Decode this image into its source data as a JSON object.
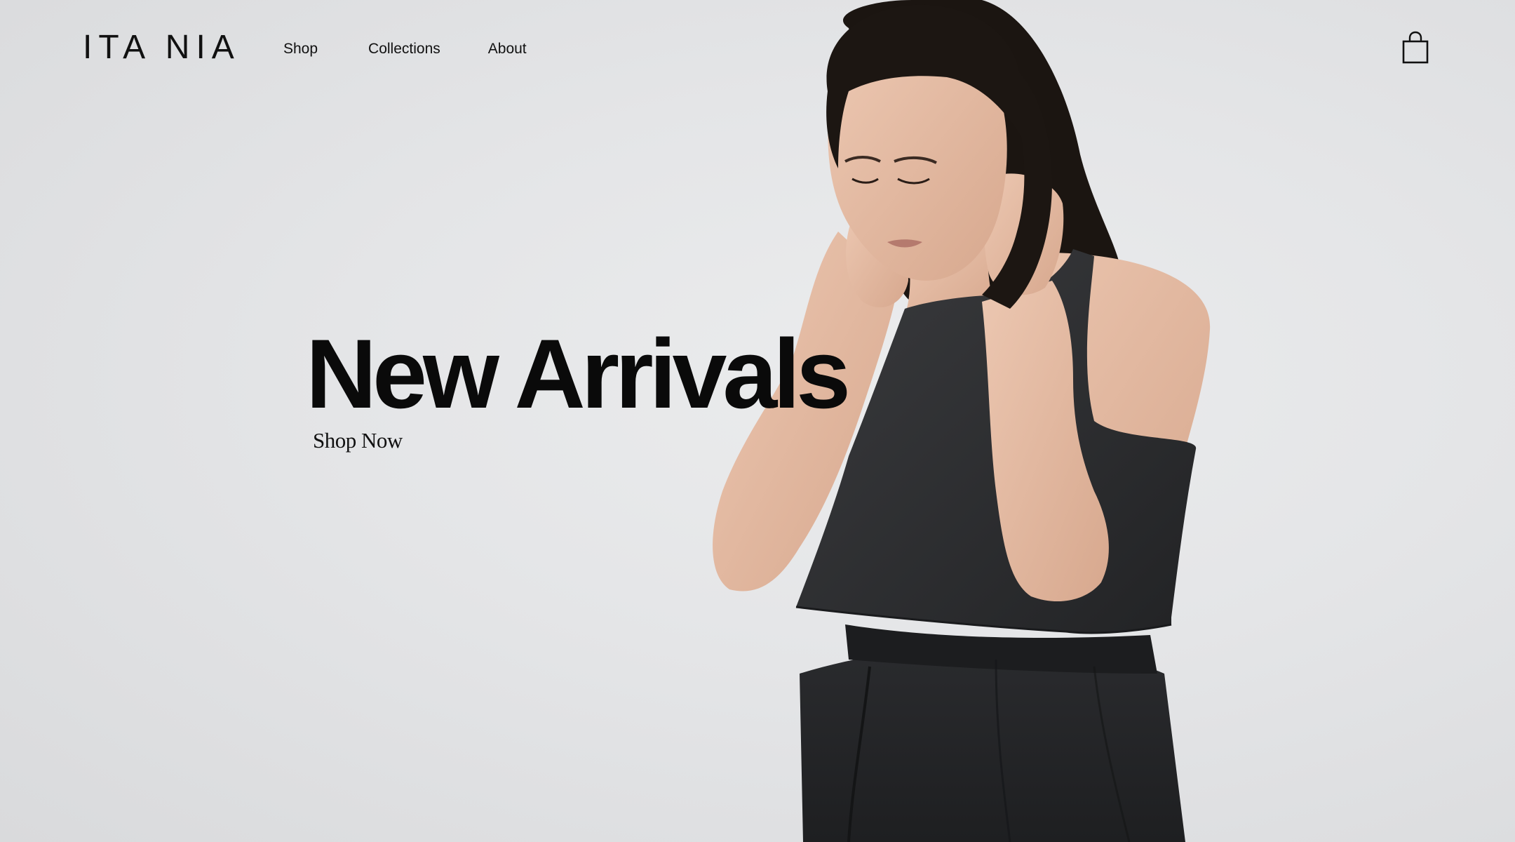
{
  "brand": {
    "logo_text": "ITA NIA"
  },
  "nav": {
    "items": [
      {
        "label": "Shop"
      },
      {
        "label": "Collections"
      },
      {
        "label": "About"
      }
    ]
  },
  "header": {
    "cart_icon": "shopping-bag-icon"
  },
  "hero": {
    "headline": "New Arrivals",
    "cta_label": "Shop Now",
    "image_subject": "model in black sleeveless top against light gray wall"
  },
  "colors": {
    "background": "#e3e4e6",
    "text": "#0b0b0b",
    "garment": "#2a2b2d",
    "skin": "#e2b9a2",
    "hair": "#1a1410"
  }
}
